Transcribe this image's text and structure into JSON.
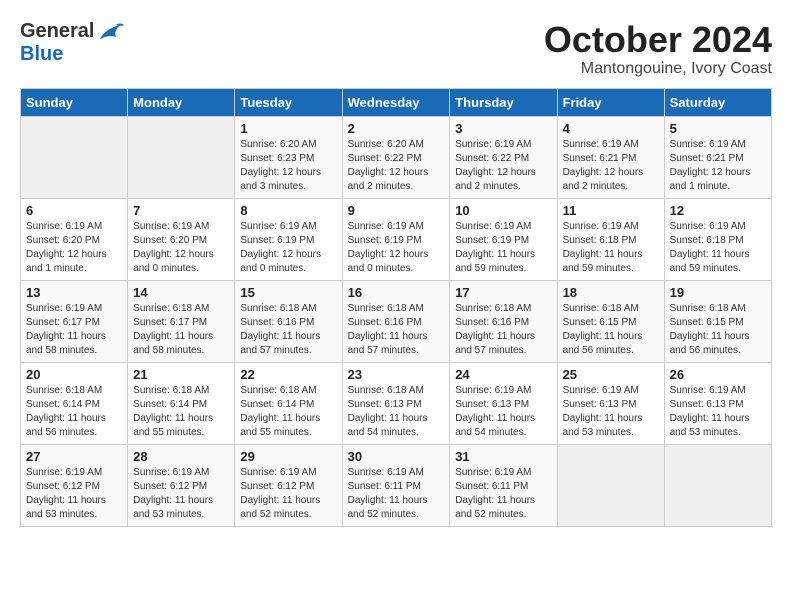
{
  "logo": {
    "general": "General",
    "blue": "Blue"
  },
  "title": "October 2024",
  "location": "Mantongouine, Ivory Coast",
  "days_of_week": [
    "Sunday",
    "Monday",
    "Tuesday",
    "Wednesday",
    "Thursday",
    "Friday",
    "Saturday"
  ],
  "weeks": [
    [
      {
        "day": "",
        "info": ""
      },
      {
        "day": "",
        "info": ""
      },
      {
        "day": "1",
        "info": "Sunrise: 6:20 AM\nSunset: 6:23 PM\nDaylight: 12 hours and 3 minutes."
      },
      {
        "day": "2",
        "info": "Sunrise: 6:20 AM\nSunset: 6:22 PM\nDaylight: 12 hours and 2 minutes."
      },
      {
        "day": "3",
        "info": "Sunrise: 6:19 AM\nSunset: 6:22 PM\nDaylight: 12 hours and 2 minutes."
      },
      {
        "day": "4",
        "info": "Sunrise: 6:19 AM\nSunset: 6:21 PM\nDaylight: 12 hours and 2 minutes."
      },
      {
        "day": "5",
        "info": "Sunrise: 6:19 AM\nSunset: 6:21 PM\nDaylight: 12 hours and 1 minute."
      }
    ],
    [
      {
        "day": "6",
        "info": "Sunrise: 6:19 AM\nSunset: 6:20 PM\nDaylight: 12 hours and 1 minute."
      },
      {
        "day": "7",
        "info": "Sunrise: 6:19 AM\nSunset: 6:20 PM\nDaylight: 12 hours and 0 minutes."
      },
      {
        "day": "8",
        "info": "Sunrise: 6:19 AM\nSunset: 6:19 PM\nDaylight: 12 hours and 0 minutes."
      },
      {
        "day": "9",
        "info": "Sunrise: 6:19 AM\nSunset: 6:19 PM\nDaylight: 12 hours and 0 minutes."
      },
      {
        "day": "10",
        "info": "Sunrise: 6:19 AM\nSunset: 6:19 PM\nDaylight: 11 hours and 59 minutes."
      },
      {
        "day": "11",
        "info": "Sunrise: 6:19 AM\nSunset: 6:18 PM\nDaylight: 11 hours and 59 minutes."
      },
      {
        "day": "12",
        "info": "Sunrise: 6:19 AM\nSunset: 6:18 PM\nDaylight: 11 hours and 59 minutes."
      }
    ],
    [
      {
        "day": "13",
        "info": "Sunrise: 6:19 AM\nSunset: 6:17 PM\nDaylight: 11 hours and 58 minutes."
      },
      {
        "day": "14",
        "info": "Sunrise: 6:18 AM\nSunset: 6:17 PM\nDaylight: 11 hours and 58 minutes."
      },
      {
        "day": "15",
        "info": "Sunrise: 6:18 AM\nSunset: 6:16 PM\nDaylight: 11 hours and 57 minutes."
      },
      {
        "day": "16",
        "info": "Sunrise: 6:18 AM\nSunset: 6:16 PM\nDaylight: 11 hours and 57 minutes."
      },
      {
        "day": "17",
        "info": "Sunrise: 6:18 AM\nSunset: 6:16 PM\nDaylight: 11 hours and 57 minutes."
      },
      {
        "day": "18",
        "info": "Sunrise: 6:18 AM\nSunset: 6:15 PM\nDaylight: 11 hours and 56 minutes."
      },
      {
        "day": "19",
        "info": "Sunrise: 6:18 AM\nSunset: 6:15 PM\nDaylight: 11 hours and 56 minutes."
      }
    ],
    [
      {
        "day": "20",
        "info": "Sunrise: 6:18 AM\nSunset: 6:14 PM\nDaylight: 11 hours and 56 minutes."
      },
      {
        "day": "21",
        "info": "Sunrise: 6:18 AM\nSunset: 6:14 PM\nDaylight: 11 hours and 55 minutes."
      },
      {
        "day": "22",
        "info": "Sunrise: 6:18 AM\nSunset: 6:14 PM\nDaylight: 11 hours and 55 minutes."
      },
      {
        "day": "23",
        "info": "Sunrise: 6:18 AM\nSunset: 6:13 PM\nDaylight: 11 hours and 54 minutes."
      },
      {
        "day": "24",
        "info": "Sunrise: 6:19 AM\nSunset: 6:13 PM\nDaylight: 11 hours and 54 minutes."
      },
      {
        "day": "25",
        "info": "Sunrise: 6:19 AM\nSunset: 6:13 PM\nDaylight: 11 hours and 53 minutes."
      },
      {
        "day": "26",
        "info": "Sunrise: 6:19 AM\nSunset: 6:13 PM\nDaylight: 11 hours and 53 minutes."
      }
    ],
    [
      {
        "day": "27",
        "info": "Sunrise: 6:19 AM\nSunset: 6:12 PM\nDaylight: 11 hours and 53 minutes."
      },
      {
        "day": "28",
        "info": "Sunrise: 6:19 AM\nSunset: 6:12 PM\nDaylight: 11 hours and 53 minutes."
      },
      {
        "day": "29",
        "info": "Sunrise: 6:19 AM\nSunset: 6:12 PM\nDaylight: 11 hours and 52 minutes."
      },
      {
        "day": "30",
        "info": "Sunrise: 6:19 AM\nSunset: 6:11 PM\nDaylight: 11 hours and 52 minutes."
      },
      {
        "day": "31",
        "info": "Sunrise: 6:19 AM\nSunset: 6:11 PM\nDaylight: 11 hours and 52 minutes."
      },
      {
        "day": "",
        "info": ""
      },
      {
        "day": "",
        "info": ""
      }
    ]
  ]
}
